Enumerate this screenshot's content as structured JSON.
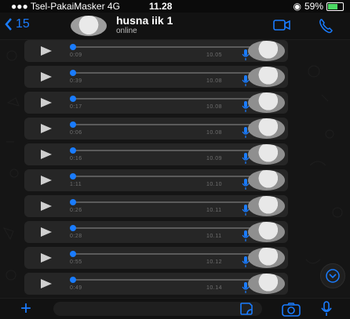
{
  "status": {
    "carrier": "Tsel-PakaiMasker",
    "network": "4G",
    "time": "11.28",
    "battery": "59%",
    "battery_level": 0.59
  },
  "header": {
    "back_count": "15",
    "contact_name": "husna iik 1",
    "presence": "online"
  },
  "messages": [
    {
      "duration": "0:09",
      "time": "10.05"
    },
    {
      "duration": "0:39",
      "time": "10.08"
    },
    {
      "duration": "0:17",
      "time": "10.08"
    },
    {
      "duration": "0:06",
      "time": "10.08"
    },
    {
      "duration": "0:16",
      "time": "10.09"
    },
    {
      "duration": "1:11",
      "time": "10.10"
    },
    {
      "duration": "0:26",
      "time": "10.11"
    },
    {
      "duration": "0:28",
      "time": "10.11"
    },
    {
      "duration": "0:55",
      "time": "10.12"
    },
    {
      "duration": "0:49",
      "time": "10.14"
    }
  ],
  "colors": {
    "accent": "#1a7cff",
    "bubble": "#262626",
    "background": "#151515"
  },
  "icons": {
    "back": "chevron-left-icon",
    "video": "video-camera-icon",
    "call": "phone-icon",
    "play": "play-icon",
    "mic": "microphone-icon",
    "scroll": "chevron-down-icon",
    "attach": "plus-icon",
    "sticker": "sticker-icon",
    "camera": "camera-icon"
  }
}
